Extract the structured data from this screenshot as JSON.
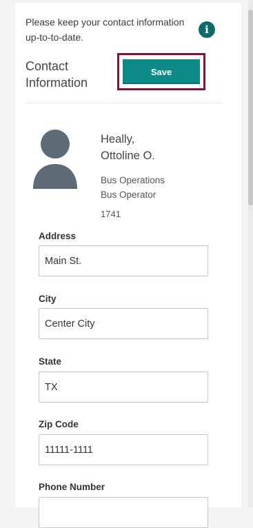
{
  "intro": {
    "text": "Please keep your contact information up-to-to-date.",
    "info_icon": "info-icon",
    "info_glyph": "i"
  },
  "section": {
    "title": "Contact Information"
  },
  "toolbar": {
    "save_label": "Save"
  },
  "employee": {
    "last_name": "Heally,",
    "first_name": "Ottoline O.",
    "department": "Bus Operations",
    "position": "Bus Operator",
    "id": "1741",
    "avatar_icon": "user-avatar-icon"
  },
  "form": {
    "address": {
      "label": "Address",
      "value": "Main St."
    },
    "city": {
      "label": "City",
      "value": "Center City"
    },
    "state": {
      "label": "State",
      "value": "TX"
    },
    "zip": {
      "label": "Zip Code",
      "value": "11111-1111"
    },
    "phone": {
      "label": "Phone Number",
      "value": ""
    }
  },
  "colors": {
    "accent": "#0d8a86",
    "info": "#0c6b68",
    "highlight_border": "#7b1436",
    "avatar": "#5c6b75"
  }
}
